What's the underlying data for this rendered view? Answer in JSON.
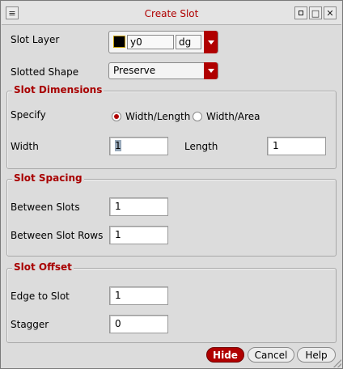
{
  "window": {
    "title": "Create Slot",
    "buttons": {
      "menu": "≡",
      "minimize": "□",
      "close": "✕"
    }
  },
  "slot_layer": {
    "label": "Slot Layer",
    "layer_name": "y0",
    "purpose": "dg",
    "swatch_color": "#000000"
  },
  "slotted_shape": {
    "label": "Slotted Shape",
    "value": "Preserve"
  },
  "slot_dimensions": {
    "title": "Slot Dimensions",
    "specify_label": "Specify",
    "option_width_length": "Width/Length",
    "option_width_area": "Width/Area",
    "selected": "Width/Length",
    "width_label": "Width",
    "width_value": "1",
    "length_label": "Length",
    "length_value": "1"
  },
  "slot_spacing": {
    "title": "Slot Spacing",
    "between_slots_label": "Between Slots",
    "between_slots_value": "1",
    "between_rows_label": "Between Slot Rows",
    "between_rows_value": "1"
  },
  "slot_offset": {
    "title": "Slot Offset",
    "edge_to_slot_label": "Edge to Slot",
    "edge_to_slot_value": "1",
    "stagger_label": "Stagger",
    "stagger_value": "0"
  },
  "footer": {
    "hide": "Hide",
    "cancel": "Cancel",
    "help": "Help"
  },
  "colors": {
    "accent": "#b00000",
    "title": "#b00000",
    "background": "#dcdcdc"
  }
}
